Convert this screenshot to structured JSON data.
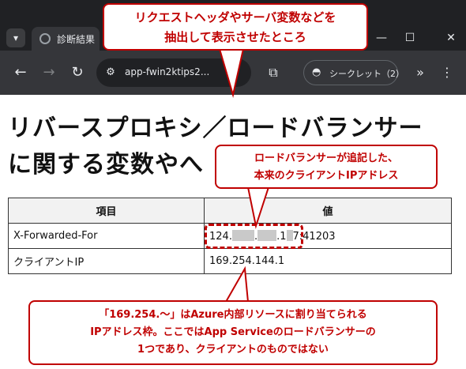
{
  "browser": {
    "tab_title": "診断結果",
    "url": "app-fwin2ktips2...",
    "incognito_label": "シークレット（2）"
  },
  "page": {
    "title_line1": "リバースプロキシ／ロードバランサー",
    "title_line2": "に関する変数やへ"
  },
  "table": {
    "headers": [
      "項目",
      "値"
    ],
    "rows": [
      {
        "name": "X-Forwarded-For",
        "value_parts": [
          "124.",
          ".",
          ".1",
          "7:41203"
        ]
      },
      {
        "name": "クライアントIP",
        "value": "169.254.144.1"
      }
    ]
  },
  "annotations": {
    "top": [
      "リクエストヘッダやサーバ変数などを",
      "抽出して表示させたところ"
    ],
    "mid": [
      "ロードバランサーが追記した、",
      "本来のクライアントIPアドレス"
    ],
    "bottom": [
      "「169.254.～」はAzure内部リソースに割り当てられる",
      "IPアドレス枠。ここではApp Serviceのロードバランサーの",
      "1つであり、クライアントのものではない"
    ]
  },
  "colors": {
    "annotation": "#c00000",
    "chrome_dark": "#202124",
    "chrome_toolbar": "#35363a"
  },
  "icons": {
    "tab_menu": "chevron-down-icon",
    "favicon": "globe-icon",
    "back": "arrow-left-icon",
    "forward": "arrow-right-icon",
    "reload": "reload-icon",
    "site_info": "tune-icon",
    "extensions": "puzzle-icon",
    "incognito": "incognito-icon",
    "more": "double-chevron-right-icon",
    "menu": "kebab-menu-icon"
  }
}
